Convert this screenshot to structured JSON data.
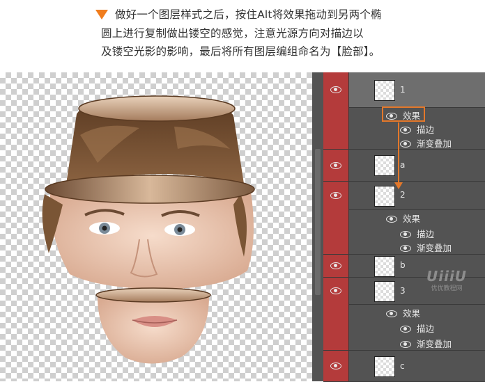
{
  "caption": {
    "line1": "做好一个图层样式之后，按住Alt将效果拖动到另两个椭",
    "line2": "圆上进行复制做出镂空的感觉，注意光源方向对描边以",
    "line3": "及镂空光影的影响，最后将所有图层编组命名为【脸部】。"
  },
  "layers": [
    {
      "name": "1",
      "effects_label": "效果",
      "effects": [
        "描边",
        "渐变叠加"
      ]
    },
    {
      "name": "a"
    },
    {
      "name": "2",
      "effects_label": "效果",
      "effects": [
        "描边",
        "渐变叠加"
      ]
    },
    {
      "name": "b"
    },
    {
      "name": "3",
      "effects_label": "效果",
      "effects": [
        "描边",
        "渐变叠加"
      ]
    },
    {
      "name": "c"
    }
  ],
  "watermark": {
    "brand": "UiiiU",
    "site": "优优教程网"
  },
  "colors": {
    "accent": "#f07d1e",
    "visibility_column": "#b43b3b",
    "panel_bg": "#535353"
  }
}
